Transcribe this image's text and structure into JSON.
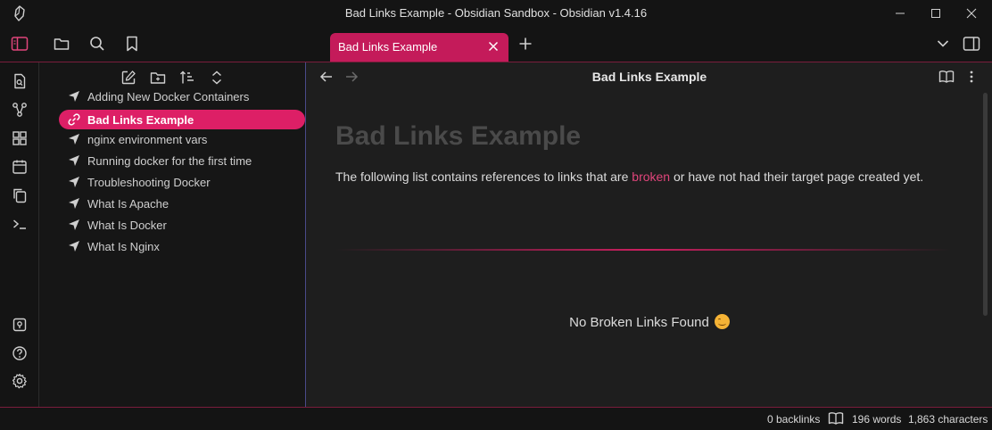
{
  "window": {
    "title": "Bad Links Example - Obsidian Sandbox - Obsidian v1.4.16"
  },
  "tabs": [
    {
      "label": "Bad Links Example",
      "active": true
    }
  ],
  "file_explorer": {
    "files": [
      {
        "label": "Adding New Docker Containers",
        "icon": "navigation-arrow-icon",
        "active": false
      },
      {
        "label": "Bad Links Example",
        "icon": "link-icon",
        "active": true
      },
      {
        "label": "nginx environment vars",
        "icon": "navigation-arrow-icon",
        "active": false
      },
      {
        "label": "Running docker for the first time",
        "icon": "navigation-arrow-icon",
        "active": false
      },
      {
        "label": "Troubleshooting Docker",
        "icon": "navigation-arrow-icon",
        "active": false
      },
      {
        "label": "What Is Apache",
        "icon": "navigation-arrow-icon",
        "active": false
      },
      {
        "label": "What Is Docker",
        "icon": "navigation-arrow-icon",
        "active": false
      },
      {
        "label": "What Is Nginx",
        "icon": "navigation-arrow-icon",
        "active": false
      }
    ]
  },
  "view": {
    "header_title": "Bad Links Example",
    "heading": "Bad Links Example",
    "paragraph_before": "The following list contains references to links that are ",
    "paragraph_link": "broken",
    "paragraph_after": " or have not had their target page created yet.",
    "empty_message": "No Broken Links Found"
  },
  "status": {
    "backlinks": "0 backlinks",
    "words": "196 words",
    "characters": "1,863 characters"
  },
  "colors": {
    "accent": "#dd1f66",
    "tab": "#c41b5a",
    "broken_link": "#e0457b"
  }
}
